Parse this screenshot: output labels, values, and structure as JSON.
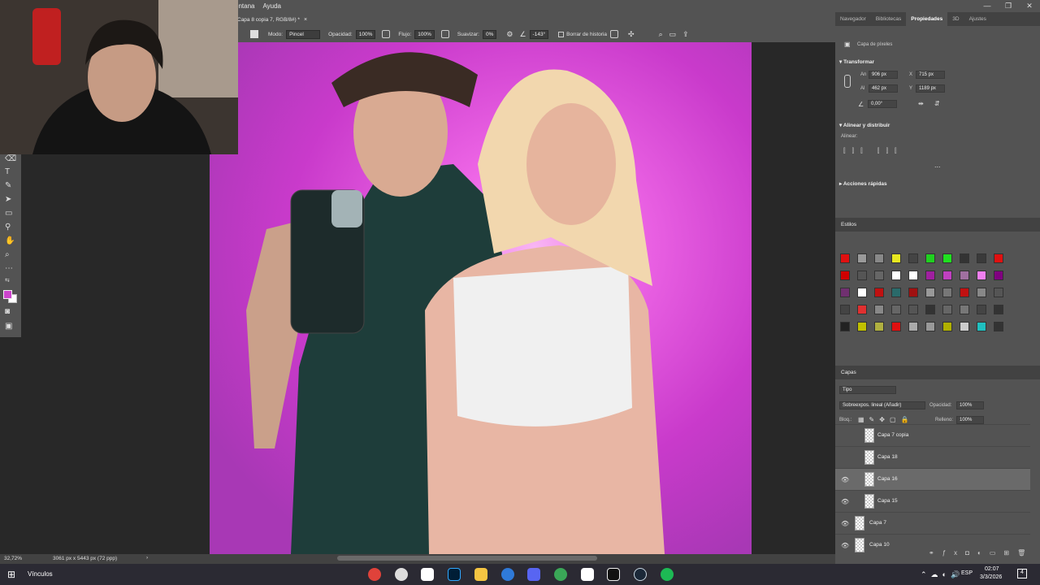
{
  "menu": {
    "items": [
      "entana",
      "Ayuda"
    ]
  },
  "document_tab": {
    "title": "Capa 8 copia 7, RGB/8#) *",
    "close": "×"
  },
  "options": {
    "modo_label": "Modo:",
    "modo_value": "Pincel",
    "opacidad_label": "Opacidad:",
    "opacidad_value": "100%",
    "flujo_label": "Flujo:",
    "flujo_value": "100%",
    "suavizar_label": "Suavizar:",
    "suavizar_value": "0%",
    "angle_value": "-143°",
    "borrar_label": "Borrar de historia"
  },
  "status": {
    "zoom": "32,72%",
    "doc_info": "3061 px x 5443 px (72 ppp)"
  },
  "panel_tabs": [
    "Navegador",
    "Bibliotecas",
    "Propiedades",
    "3D",
    "Ajustes"
  ],
  "properties": {
    "title": "Capa de píxeles",
    "transform_header": "Transformar",
    "an_label": "An",
    "an_value": "906 px",
    "x_label": "X",
    "x_value": "715 px",
    "al_label": "Al",
    "al_value": "462 px",
    "y_label": "Y",
    "y_value": "1189 px",
    "angle_value": "0,00°",
    "align_header": "Alinear y distribuir",
    "align_label": "Alinear:",
    "quick_header": "Acciones rápidas",
    "more": "..."
  },
  "styles": {
    "title": "Estilos"
  },
  "layers_panel": {
    "title": "Capas",
    "filter": "Tipo",
    "blend_mode": "Sobreexpos. lineal (Añadir)",
    "opacity_label": "Opacidad:",
    "opacity_value": "100%",
    "lock_label": "Bloq.:",
    "fill_label": "Relleno:",
    "fill_value": "100%"
  },
  "layers": [
    {
      "name": "Capa 7 copia",
      "visible": false,
      "selected": false
    },
    {
      "name": "Capa 18",
      "visible": false,
      "selected": false
    },
    {
      "name": "Capa 16",
      "visible": true,
      "selected": true
    },
    {
      "name": "Capa 15",
      "visible": true,
      "selected": false
    },
    {
      "name": "Capa 7",
      "visible": true,
      "selected": false
    },
    {
      "name": "Capa 10",
      "visible": true,
      "selected": false
    }
  ],
  "taskbar": {
    "label": "Vínculos",
    "lang": "ESP",
    "time": "02:07",
    "date": "3/3/2026",
    "notif": "4"
  },
  "colors": {
    "foreground": "#cc44cc",
    "background": "#ffffff",
    "canvas": "#e055e0"
  }
}
